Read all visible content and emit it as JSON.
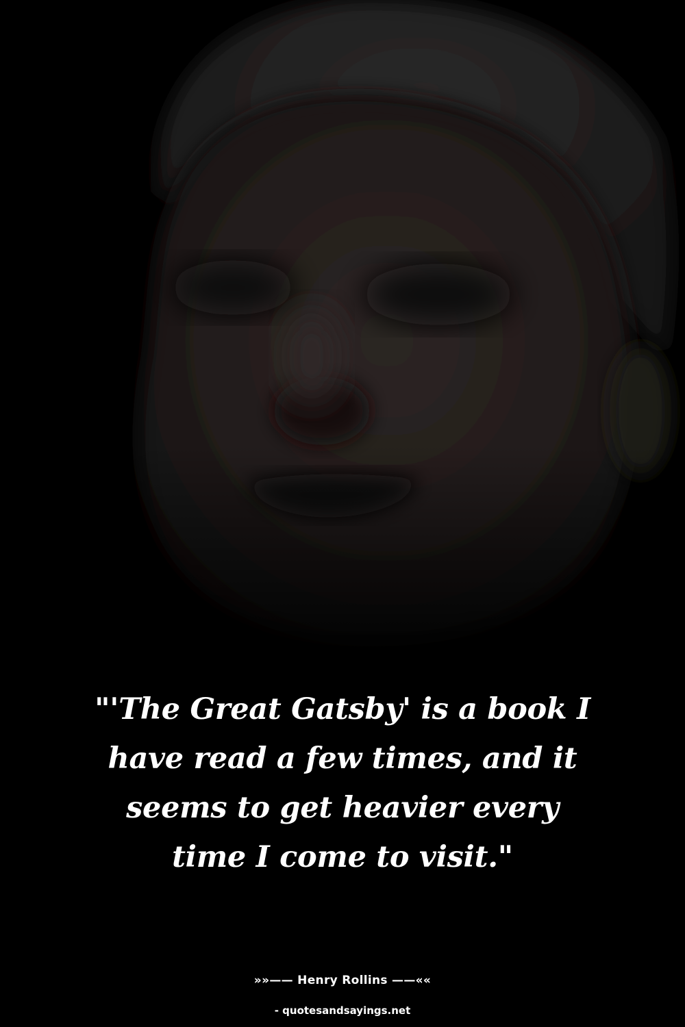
{
  "background": {
    "color": "#000000",
    "image": "portrait-photo"
  },
  "quote": {
    "text": "\"'The Great Gatsby' is a book I have read a few times, and it seems to get heavier every time I come to visit.\""
  },
  "author": {
    "line": "»»—— Henry Rollins ——««"
  },
  "source": {
    "credit": "- quotesandsayings.net"
  }
}
